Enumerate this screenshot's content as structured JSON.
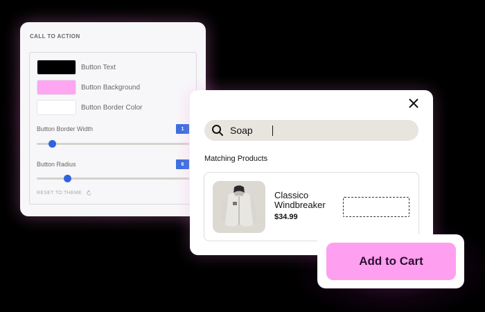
{
  "settings": {
    "title": "CALL TO ACTION",
    "swatches": [
      {
        "label": "Button Text",
        "color": "#000000"
      },
      {
        "label": "Button Background",
        "color": "#ffa6f2"
      },
      {
        "label": "Button Border Color",
        "color": "#ffffff"
      }
    ],
    "border_width": {
      "label": "Button Border Width",
      "value": "1",
      "level": 0.1
    },
    "radius": {
      "label": "Button Radius",
      "value": "6",
      "level": 0.2
    },
    "reset_label": "RESET TO THEME"
  },
  "search": {
    "query": "Soap",
    "section_heading": "Matching Products",
    "product": {
      "name": "Classico Windbreaker",
      "price": "$34.99"
    }
  },
  "cart": {
    "button_label": "Add to Cart"
  },
  "colors": {
    "accent_blue": "#3162e0",
    "cta_pink": "#ff9ff0",
    "background": "#000000"
  },
  "icons": {
    "close": "close-icon",
    "search": "search-icon",
    "reset": "refresh-icon"
  }
}
